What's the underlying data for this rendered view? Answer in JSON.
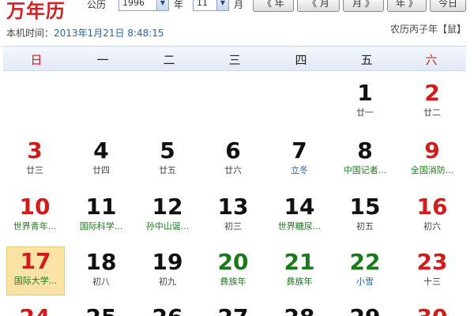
{
  "app": {
    "title": "万年历"
  },
  "controls": {
    "calendar_label": "公历",
    "year_value": "1996",
    "year_unit": "年",
    "month_value": "11",
    "month_unit": "月",
    "prev_year_label": "《 年",
    "prev_month_label": "《 月",
    "next_month_label": "月 》",
    "next_year_label": "年 》",
    "today_label": "今日"
  },
  "status": {
    "now_label": "本机时间：",
    "now_value": "2013年1月21日 8:48:15",
    "lunar_year": "农历丙子年【鼠】"
  },
  "weekdays": [
    "日",
    "一",
    "二",
    "三",
    "四",
    "五",
    "六"
  ],
  "weeks": [
    [
      {
        "day": "",
        "sub": ""
      },
      {
        "day": "",
        "sub": ""
      },
      {
        "day": "",
        "sub": ""
      },
      {
        "day": "",
        "sub": ""
      },
      {
        "day": "",
        "sub": ""
      },
      {
        "day": "1",
        "sub": "廿一"
      },
      {
        "day": "2",
        "sub": "廿二"
      }
    ],
    [
      {
        "day": "3",
        "sub": "廿三"
      },
      {
        "day": "4",
        "sub": "廿四"
      },
      {
        "day": "5",
        "sub": "廿五"
      },
      {
        "day": "6",
        "sub": "廿六"
      },
      {
        "day": "7",
        "sub": "立冬"
      },
      {
        "day": "8",
        "sub": "中国记者..."
      },
      {
        "day": "9",
        "sub": "全国消防..."
      }
    ],
    [
      {
        "day": "10",
        "sub": "世界青年..."
      },
      {
        "day": "11",
        "sub": "国际科学..."
      },
      {
        "day": "12",
        "sub": "孙中山诞..."
      },
      {
        "day": "13",
        "sub": "初三"
      },
      {
        "day": "14",
        "sub": "世界糖尿..."
      },
      {
        "day": "15",
        "sub": "初五"
      },
      {
        "day": "16",
        "sub": "初六"
      }
    ],
    [
      {
        "day": "17",
        "sub": "国际大学..."
      },
      {
        "day": "18",
        "sub": "初八"
      },
      {
        "day": "19",
        "sub": "初九"
      },
      {
        "day": "20",
        "sub": "彝族年"
      },
      {
        "day": "21",
        "sub": "彝族年"
      },
      {
        "day": "22",
        "sub": "小雪"
      },
      {
        "day": "23",
        "sub": "十三"
      }
    ],
    [
      {
        "day": "24",
        "sub": ""
      },
      {
        "day": "25",
        "sub": ""
      },
      {
        "day": "26",
        "sub": ""
      },
      {
        "day": "27",
        "sub": ""
      },
      {
        "day": "28",
        "sub": ""
      },
      {
        "day": "29",
        "sub": ""
      },
      {
        "day": "30",
        "sub": ""
      }
    ]
  ],
  "colors": {
    "weekend_red": "#d21c1c",
    "festival_green": "#1c7a1c",
    "solar_term_blue": "#2a62a8",
    "today_highlight": "#fbe3a6"
  }
}
